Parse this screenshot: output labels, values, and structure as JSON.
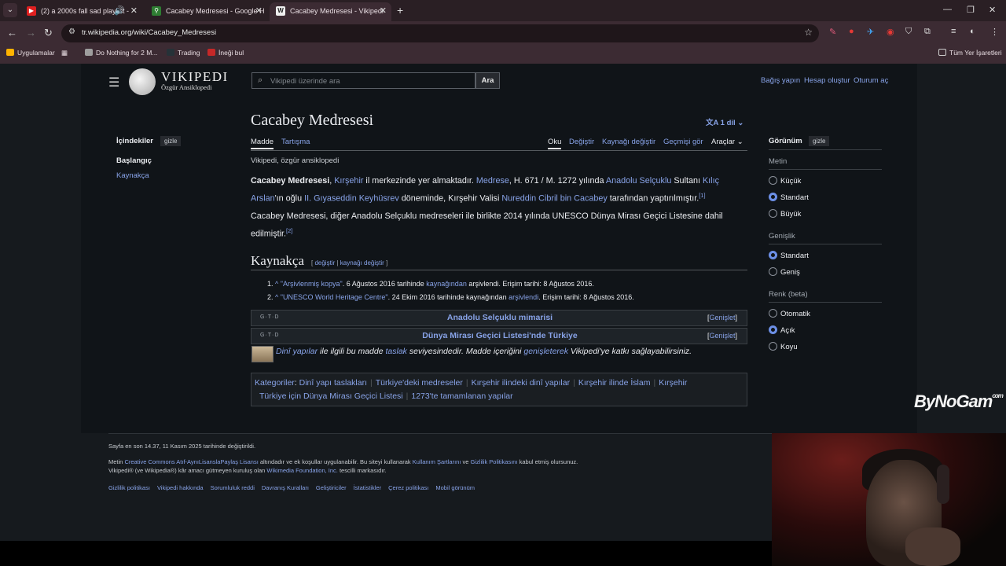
{
  "browser": {
    "tabs": [
      {
        "title": "(2) a 2000s fall sad playlist -",
        "favicon": "youtube-icon"
      },
      {
        "title": "Cacabey Medresesi - Google H",
        "favicon": "maps-pin-icon"
      },
      {
        "title": "Cacabey Medresesi - Vikipedi",
        "favicon": "wikipedia-icon",
        "active": true
      }
    ],
    "url": "tr.wikipedia.org/wiki/Cacabey_Medresesi",
    "bookmarks": [
      {
        "label": "Uygulamalar"
      },
      {
        "label": "Do Nothing for 2 M..."
      },
      {
        "label": "Trading"
      },
      {
        "label": "İneği bul"
      }
    ],
    "all_bookmarks": "Tüm Yer İşaretleri"
  },
  "wiki": {
    "logo_title": "VIKIPEDI",
    "logo_subtitle": "Özgür Ansiklopedi",
    "search_placeholder": "Vikipedi üzerinde ara",
    "search_button": "Ara",
    "top_links": [
      "Bağış yapın",
      "Hesap oluştur",
      "Oturum aç"
    ],
    "page_title": "Cacabey Medresesi",
    "lang_button": "1 dil",
    "tabs_left": [
      "Madde",
      "Tartışma"
    ],
    "tabs_right": [
      "Oku",
      "Değiştir",
      "Kaynağı değiştir",
      "Geçmişi gör",
      "Araçlar"
    ],
    "tagline": "Vikipedi, özgür ansiklopedi",
    "p1": {
      "bold": "Cacabey Medresesi",
      "t1": ", ",
      "l1": "Kırşehir",
      "t2": " il merkezinde yer almaktadır. ",
      "l2": "Medrese",
      "t3": ", H. 671 / M. 1272 yılında ",
      "l3": "Anadolu Selçuklu",
      "t4": " Sultanı ",
      "l4": "Kılıç Arslan",
      "t5": "'ın oğlu ",
      "l5": "II. Gıyaseddin Keyhüsrev",
      "t6": " döneminde, Kırşehir Valisi ",
      "l6": "Nureddin Cibril bin Cacabey",
      "t7": " tarafından yaptırılmıştır.",
      "ref": "[1]"
    },
    "p2": {
      "text": "Cacabey Medresesi, diğer Anadolu Selçuklu medreseleri ile birlikte 2014 yılında UNESCO Dünya Mirası Geçici Listesine dahil edilmiştir.",
      "ref": "[2]"
    },
    "refs_heading": "Kaynakça",
    "refs_edit": {
      "open": "[ ",
      "edit": "değiştir",
      "sep": " | ",
      "source": "kaynağı değiştir",
      "close": " ]"
    },
    "references": [
      {
        "num": "1.",
        "caret": "^",
        "link": "\"Arşivlenmiş kopya\"",
        "mid": ". 6 Ağustos 2016 tarihinde ",
        "link2": "kaynağından",
        "end": " arşivlendi. Erişim tarihi: 8 Ağustos 2016."
      },
      {
        "num": "2.",
        "caret": "^",
        "link": "\"UNESCO World Heritage Centre\"",
        "mid": ". 24 Ekim 2016 tarihinde kaynağından ",
        "link2": "arşivlendi",
        "end": ". Erişim tarihi: 8 Ağustos 2016."
      }
    ],
    "navboxes": [
      {
        "vtd": "G·T·D",
        "title": "Anadolu Selçuklu mimarisi",
        "expand": "Genişlet"
      },
      {
        "vtd": "G·T·D",
        "title": "Dünya Mirası Geçici Listesi'nde Türkiye",
        "expand": "Genişlet"
      }
    ],
    "stub": {
      "link1": "Dinî yapılar",
      "t1": " ile ilgili bu madde ",
      "link2": "taslak",
      "t2": " seviyesindedir. Madde içeriğini ",
      "link3": "genişleterek",
      "t3": " Vikipedi'ye katkı sağlayabilirsiniz."
    },
    "categories_label": "Kategoriler",
    "categories": [
      "Dinî yapı taslakları",
      "Türkiye'deki medreseler",
      "Kırşehir ilindeki dinî yapılar",
      "Kırşehir ilinde İslam",
      "Kırşehir",
      "Türkiye için Dünya Mirası Geçici Listesi",
      "1273'te tamamlanan yapılar"
    ],
    "toc": {
      "heading": "İçindekiler",
      "hide": "gizle",
      "items": [
        "Başlangıç",
        "Kaynakça"
      ]
    },
    "appearance": {
      "heading": "Görünüm",
      "hide": "gizle",
      "text_label": "Metin",
      "text_options": [
        "Küçük",
        "Standart",
        "Büyük"
      ],
      "width_label": "Genişlik",
      "width_options": [
        "Standart",
        "Geniş"
      ],
      "color_label": "Renk (beta)",
      "color_options": [
        "Otomatik",
        "Açık",
        "Koyu"
      ]
    },
    "footer": {
      "last_edit": "Sayfa en son 14.37, 11 Kasım 2025 tarihinde değiştirildi.",
      "l1a": "Metin ",
      "l1b": "Creative Commons Atıf-AynıLisanslaPaylaş Lisansı",
      "l1c": " altındadır ve ek koşullar uygulanabilir. Bu siteyi kullanarak ",
      "l1d": "Kullanım Şartlarını",
      "l1e": " ve ",
      "l1f": "Gizlilik Politikasını",
      "l1g": " kabul etmiş olursunuz.",
      "l2a": "Vikipedi® (ve Wikipedia®) kâr amacı gütmeyen kuruluş olan ",
      "l2b": "Wikimedia Foundation, Inc.",
      "l2c": " tescilli markasıdır.",
      "links": [
        "Gizlilik politikası",
        "Vikipedi hakkında",
        "Sorumluluk reddi",
        "Davranış Kuralları",
        "Geliştiriciler",
        "İstatistikler",
        "Çerez politikası",
        "Mobil görünüm"
      ]
    }
  },
  "overlay": {
    "brand": "ByNoGam",
    "brand_suffix": "com"
  }
}
